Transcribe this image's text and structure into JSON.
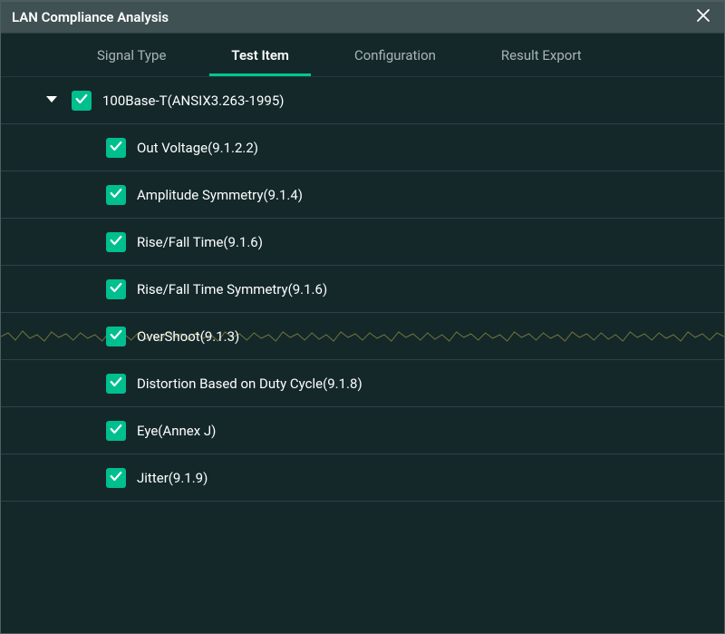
{
  "colors": {
    "accent": "#00c791",
    "checkbox": "#00bf8f",
    "titlebar_bg": "#3f5152",
    "body_bg": "#14282a",
    "divider": "#2b4446"
  },
  "titlebar": {
    "title": "LAN Compliance Analysis"
  },
  "tabs": {
    "items": [
      {
        "label": "Signal Type",
        "active": false
      },
      {
        "label": "Test Item",
        "active": true
      },
      {
        "label": "Configuration",
        "active": false
      },
      {
        "label": "Result Export",
        "active": false
      }
    ]
  },
  "tree": {
    "parent": {
      "label": "100Base-T(ANSIX3.263-1995)",
      "checked": true,
      "expanded": true
    },
    "children": [
      {
        "label": "Out Voltage(9.1.2.2)",
        "checked": true
      },
      {
        "label": "Amplitude Symmetry(9.1.4)",
        "checked": true
      },
      {
        "label": "Rise/Fall Time(9.1.6)",
        "checked": true
      },
      {
        "label": "Rise/Fall Time Symmetry(9.1.6)",
        "checked": true
      },
      {
        "label": "OverShoot(9.1.3)",
        "checked": true
      },
      {
        "label": "Distortion Based on Duty Cycle(9.1.8)",
        "checked": true
      },
      {
        "label": "Eye(Annex J)",
        "checked": true
      },
      {
        "label": "Jitter(9.1.9)",
        "checked": true
      }
    ]
  }
}
